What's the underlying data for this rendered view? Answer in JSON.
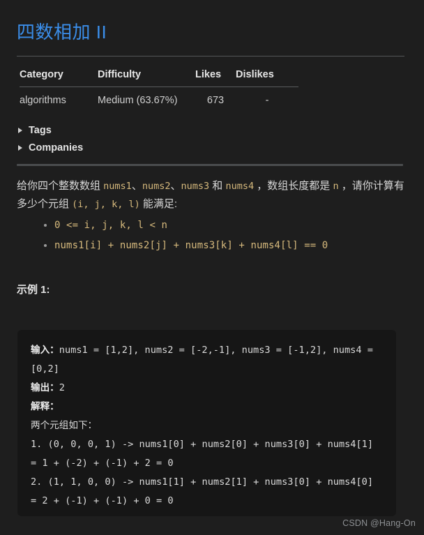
{
  "title": "四数相加 II",
  "meta_table": {
    "headers": [
      "Category",
      "Difficulty",
      "Likes",
      "Dislikes"
    ],
    "row": {
      "category": "algorithms",
      "difficulty": "Medium (63.67%)",
      "likes": "673",
      "dislikes": "-"
    }
  },
  "disclosures": [
    {
      "label": "Tags",
      "marker": "triangle-right-icon"
    },
    {
      "label": "Companies",
      "marker": "triangle-right-icon"
    }
  ],
  "description": {
    "line1_prefix": "给你四个整数数组 ",
    "code_nums1": "nums1",
    "sep1": "、",
    "code_nums2": "nums2",
    "sep2": "、",
    "code_nums3": "nums3",
    "mid": " 和 ",
    "code_nums4": "nums4",
    "line1_suffix": " ，数组长度都是 ",
    "code_n": "n",
    "line1_end": " ，请你计算有多少个元组 ",
    "code_tuple": "(i, j, k, l)",
    "line2_end": " 能满足:",
    "bullets": [
      "0 <= i, j, k, l < n",
      "nums1[i] + nums2[j] + nums3[k] + nums4[l] == 0"
    ]
  },
  "example_heading": "示例 1:",
  "code_block": {
    "lines": [
      {
        "label": "输入：",
        "text": "nums1 = [1,2], nums2 = [-2,-1], nums3 = [-1,2], nums4 = [0,2]"
      },
      {
        "label": "输出：",
        "text": "2"
      },
      {
        "label": "解释：",
        "text": ""
      },
      {
        "label": "",
        "text": "两个元组如下："
      },
      {
        "label": "",
        "text": "1. (0, 0, 0, 1) -> nums1[0] + nums2[0] + nums3[0] + nums4[1] = 1 + (-2) + (-1) + 2 = 0"
      },
      {
        "label": "",
        "text": "2. (1, 1, 0, 0) -> nums1[1] + nums2[1] + nums3[0] + nums4[0] = 2 + (-1) + (-1) + 0 = 0"
      }
    ]
  },
  "watermark": "CSDN @Hang-On",
  "colors": {
    "page_background": "#1e1e1e",
    "title_blue": "#3b8eea",
    "code_amber": "#d7ba7d",
    "code_block_background": "#161616",
    "body_text": "#d8d8d8"
  }
}
